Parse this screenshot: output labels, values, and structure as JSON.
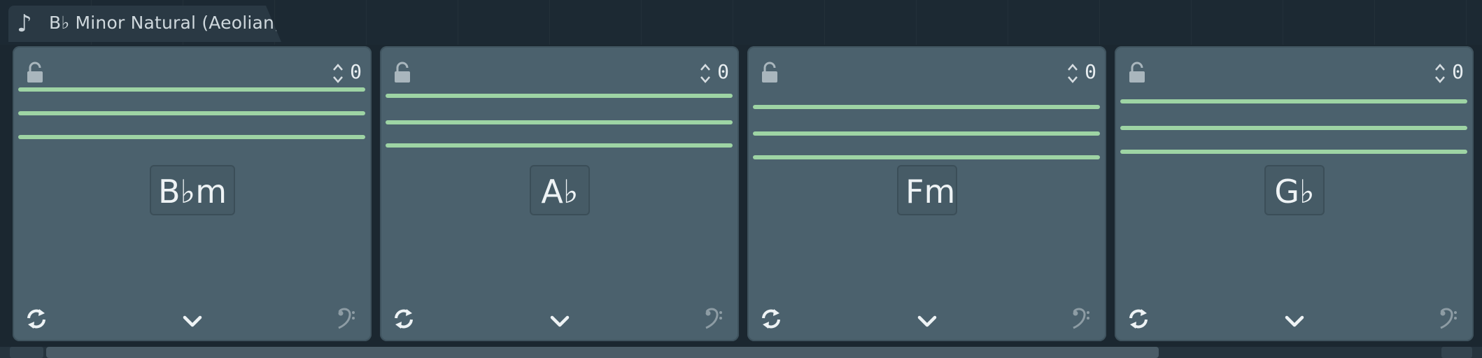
{
  "header": {
    "scale_label": "B♭ Minor Natural (Aeolian)",
    "note_icon": "eighth-note-icon"
  },
  "colors": {
    "panel_bg": "#4b616d",
    "note_line": "#9ed4a4",
    "header_bg": "#1c2933"
  },
  "chords": [
    {
      "name": "B♭m",
      "transpose": "0",
      "line_levels": [
        0.86,
        0.78,
        0.7
      ]
    },
    {
      "name": "A♭",
      "transpose": "0",
      "line_levels": [
        0.84,
        0.75,
        0.67
      ]
    },
    {
      "name": "Fm",
      "transpose": "0",
      "line_levels": [
        0.8,
        0.71,
        0.63
      ]
    },
    {
      "name": "G♭",
      "transpose": "0",
      "line_levels": [
        0.82,
        0.73,
        0.65
      ]
    }
  ],
  "icons": {
    "lock": "lock-icon",
    "stepper": "up-down-chevron-icon",
    "cycle": "cycle-icon",
    "dropdown": "chevron-down-icon",
    "bass_clef": "bass-clef-icon"
  }
}
